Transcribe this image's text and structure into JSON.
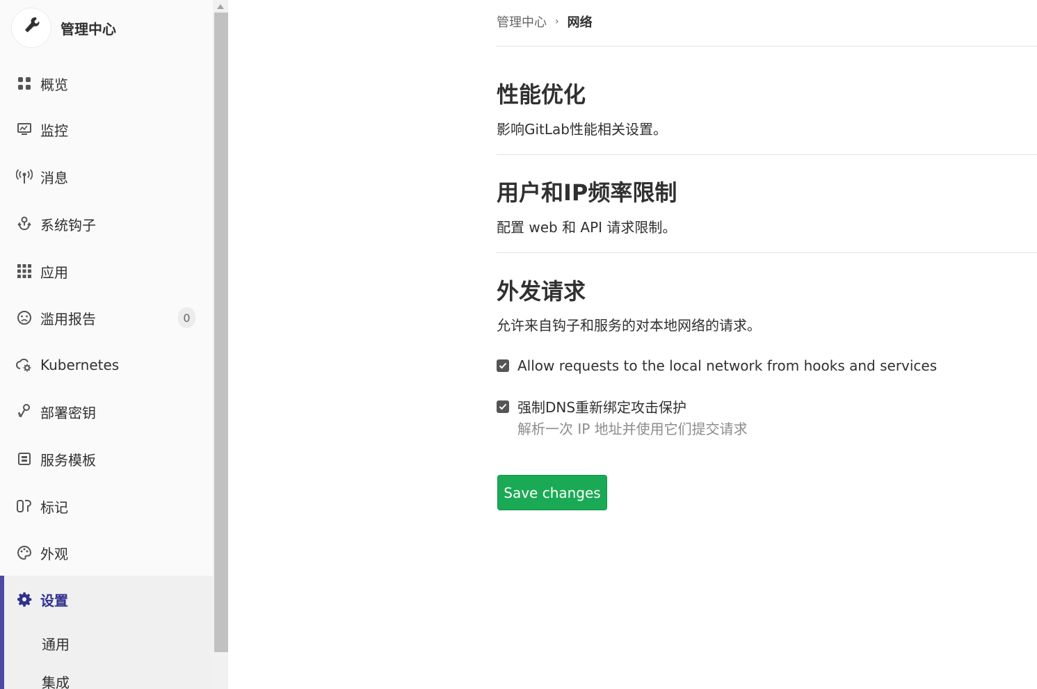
{
  "sidebar": {
    "title": "管理中心",
    "items": [
      {
        "label": "概览",
        "icon": "overview-grid-icon"
      },
      {
        "label": "监控",
        "icon": "monitor-icon"
      },
      {
        "label": "消息",
        "icon": "broadcast-icon"
      },
      {
        "label": "系统钩子",
        "icon": "hook-icon"
      },
      {
        "label": "应用",
        "icon": "apps-grid-icon"
      },
      {
        "label": "滥用报告",
        "icon": "frown-face-icon",
        "badge": "0"
      },
      {
        "label": "Kubernetes",
        "icon": "cloud-gear-icon"
      },
      {
        "label": "部署密钥",
        "icon": "key-icon"
      },
      {
        "label": "服务模板",
        "icon": "template-icon"
      },
      {
        "label": "标记",
        "icon": "labels-icon"
      },
      {
        "label": "外观",
        "icon": "palette-icon"
      },
      {
        "label": "设置",
        "icon": "gear-icon",
        "active": true
      }
    ],
    "sub_items": [
      {
        "label": "通用"
      },
      {
        "label": "集成"
      }
    ]
  },
  "breadcrumb": {
    "parent": "管理中心",
    "current": "网络"
  },
  "sections": [
    {
      "title": "性能优化",
      "description": "影响GitLab性能相关设置。"
    },
    {
      "title": "用户和IP频率限制",
      "description": "配置 web 和 API 请求限制。"
    },
    {
      "title": "外发请求",
      "description": "允许来自钩子和服务的对本地网络的请求。"
    }
  ],
  "outbound": {
    "allow_local_label": "Allow requests to the local network from hooks and services",
    "allow_local_checked": true,
    "dns_rebind_label": "强制DNS重新绑定攻击保护",
    "dns_rebind_checked": true,
    "dns_rebind_help": "解析一次 IP 地址并使用它们提交请求"
  },
  "save_button": "Save changes",
  "colors": {
    "accent": "#4b4ba3",
    "save_green": "#1aaa55"
  }
}
